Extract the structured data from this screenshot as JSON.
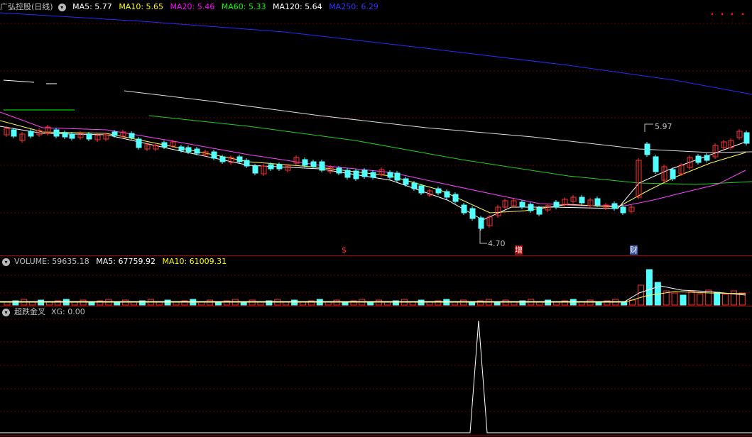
{
  "main": {
    "title": "广弘控股(日线)",
    "ma_labels": [
      {
        "text": "MA5: 5.77",
        "color": "#ffffff"
      },
      {
        "text": "MA10: 5.65",
        "color": "#ffff00"
      },
      {
        "text": "MA20: 5.46",
        "color": "#ff00ff"
      },
      {
        "text": "MA60: 5.33",
        "color": "#00ff00"
      },
      {
        "text": "MA120: 5.64",
        "color": "#ffffff"
      },
      {
        "text": "MA250: 6.29",
        "color": "#3333ff"
      }
    ],
    "high_label": "5.97",
    "low_label": "4.70",
    "markers": {
      "s": "$",
      "zeng": "增",
      "cai": "财"
    }
  },
  "volume": {
    "label": "VOLUME: 59635.18",
    "ma5": "MA5: 67759.92",
    "ma10": "MA10: 61009.31"
  },
  "indicator": {
    "name": "超跌金叉",
    "xg": "XG: 0.00"
  },
  "colors": {
    "up": "#ff3232",
    "down": "#54ffff",
    "grid": "#8b0000"
  }
}
